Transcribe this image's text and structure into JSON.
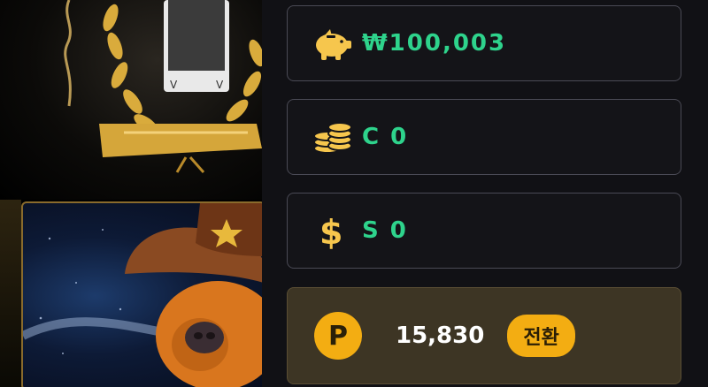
{
  "wallet": {
    "krw": {
      "icon": "piggy-bank-icon",
      "value": "₩100,003"
    },
    "coin": {
      "icon": "coins-icon",
      "value": "C 0"
    },
    "sub": {
      "icon": "dollar-icon",
      "value": "S 0"
    },
    "points": {
      "icon": "point-icon",
      "badge": "P",
      "value": "15,830",
      "convert_label": "전환"
    }
  },
  "colors": {
    "accent": "#2ed38c",
    "gold": "#f3ad12",
    "icon": "#f6c64d"
  }
}
